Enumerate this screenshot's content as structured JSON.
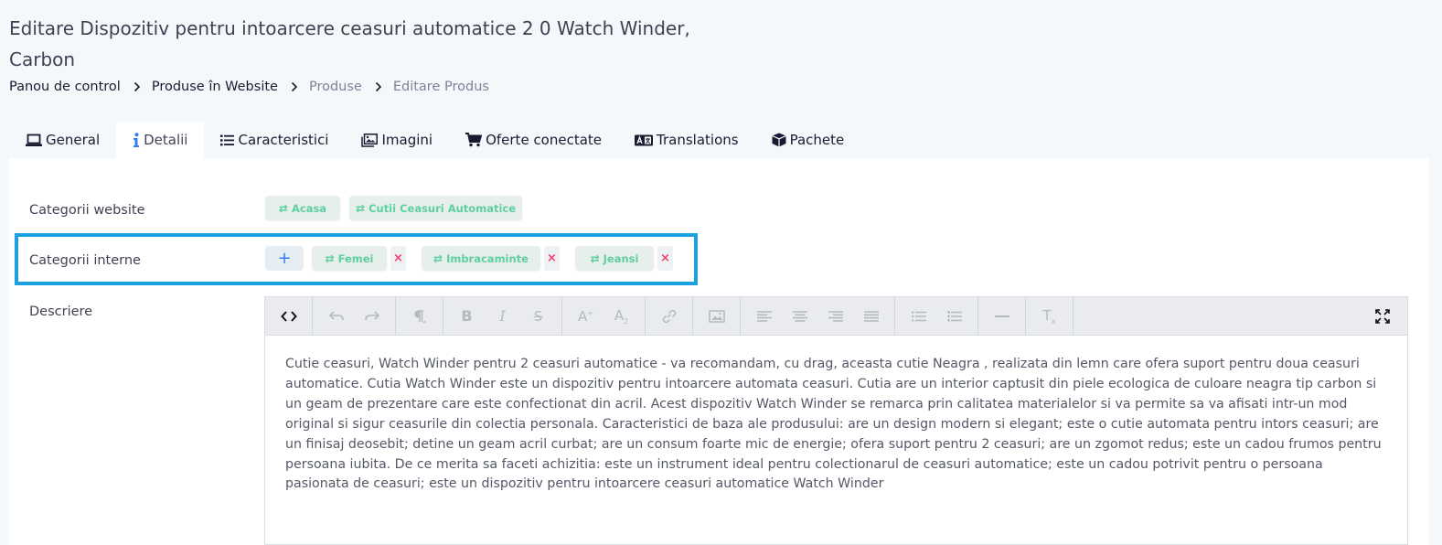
{
  "page": {
    "title": "Editare Dispozitiv pentru intoarcere ceasuri automatice 2 0 Watch Winder, Carbon"
  },
  "breadcrumb": {
    "items": [
      "Panou de control",
      "Produse în Website",
      "Produse",
      "Editare Produs"
    ]
  },
  "tabs": [
    {
      "label": "General",
      "icon": "laptop-icon"
    },
    {
      "label": "Detalii",
      "icon": "info-icon",
      "active": true
    },
    {
      "label": "Caracteristici",
      "icon": "list-icon"
    },
    {
      "label": "Imagini",
      "icon": "images-icon"
    },
    {
      "label": "Oferte conectate",
      "icon": "cart-icon"
    },
    {
      "label": "Translations",
      "icon": "translate-icon"
    },
    {
      "label": "Pachete",
      "icon": "box-icon"
    }
  ],
  "form": {
    "website_categories": {
      "label": "Categorii website",
      "chips": [
        "Acasa",
        "Cutii Ceasuri Automatice"
      ]
    },
    "internal_categories": {
      "label": "Categorii interne",
      "add_label": "+",
      "remove_label": "×",
      "chips": [
        "Femei",
        "Imbracaminte",
        "Jeansi"
      ]
    },
    "description": {
      "label": "Descriere",
      "text": "Cutie ceasuri, Watch Winder pentru 2 ceasuri automatice - va recomandam, cu drag, aceasta cutie Neagra , realizata din lemn care ofera suport pentru doua ceasuri automatice. Cutia Watch Winder este un dispozitiv pentru intoarcere automata ceasuri. Cutia are un interior captusit din piele ecologica de culoare neagra tip carbon  si un geam de prezentare care este confectionat din acril. Acest dispozitiv Watch Winder se remarca prin calitatea materialelor si va permite sa va afisati intr-un mod original si sigur ceasurile din colectia personala.  Caracteristici de baza ale produsului: are un design modern si elegant; este o cutie automata pentru intors ceasuri; are un finisaj deosebit; detine un geam acril curbat; are un consum foarte mic de energie; ofera suport pentru 2 ceasuri; are un zgomot redus; este un cadou frumos pentru persoana iubita. De ce merita sa faceti achizitia: este un instrument ideal pentru colectionarul de ceasuri automatice; este un cadou potrivit pentru o persoana pasionata de ceasuri; este un dispozitiv pentru intoarcere ceasuri automatice Watch Winder"
    }
  },
  "toolbar_icons": [
    "code-view-icon",
    "undo-icon",
    "redo-icon",
    "paragraph-icon",
    "bold-icon",
    "italic-icon",
    "strikethrough-icon",
    "superscript-icon",
    "subscript-icon",
    "link-icon",
    "image-icon",
    "align-left-icon",
    "align-center-icon",
    "align-right-icon",
    "align-justify-icon",
    "unordered-list-icon",
    "ordered-list-icon",
    "horizontal-rule-icon",
    "clear-format-icon",
    "fullscreen-icon"
  ],
  "colors": {
    "highlight": "#1aa0e0",
    "chip_text": "#5fcf9f",
    "remove": "#f1416c",
    "add": "#2f7ff0"
  }
}
